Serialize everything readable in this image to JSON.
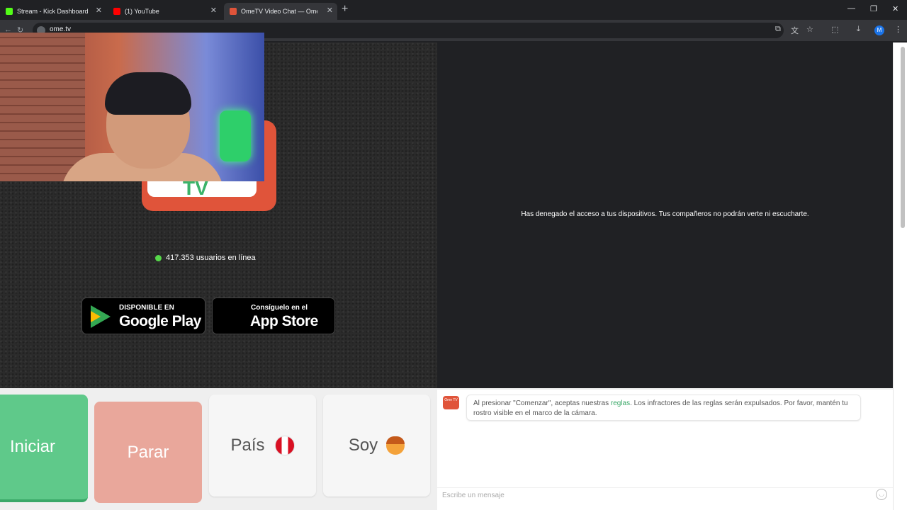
{
  "browser": {
    "tabs": [
      {
        "label": "Stream - Kick Dashboard",
        "favicon_color": "#53fc18"
      },
      {
        "label": "(1) YouTube",
        "favicon_color": "#ff0000"
      },
      {
        "label": "OmeTV Video Chat — Ome",
        "favicon_color": "#e0543a",
        "active": true
      }
    ],
    "url": "ome.tv",
    "profile_initial": "M",
    "new_tab_icon": "+",
    "tab_close_icon": "✕"
  },
  "page": {
    "logo_text": "TV",
    "online_count_text": "417.353 usuarios en línea",
    "google_play": {
      "small": "DISPONIBLE EN",
      "big": "Google Play"
    },
    "app_store": {
      "small": "Consíguelo en el",
      "big": "App Store"
    },
    "denied_message": "Has denegado el acceso a tus dispositivos. Tus compañeros no podrán verte ni escucharte."
  },
  "controls": {
    "start_label": "Iniciar",
    "stop_label": "Parar",
    "country_label": "País",
    "gender_label": "Soy"
  },
  "chat": {
    "logo_text": "Ome TV",
    "rules_before": "Al presionar \"Comenzar\", aceptas nuestras ",
    "rules_link": "reglas",
    "rules_after": ". Los infractores de las reglas serán expulsados. Por favor, mantén tu rostro visible en el marco de la cámara.",
    "input_placeholder": "Escribe un mensaje"
  },
  "colors": {
    "start": "#5fc98a",
    "stop": "#e9a79b",
    "brand": "#e0543a",
    "online_dot": "#56d84a"
  }
}
